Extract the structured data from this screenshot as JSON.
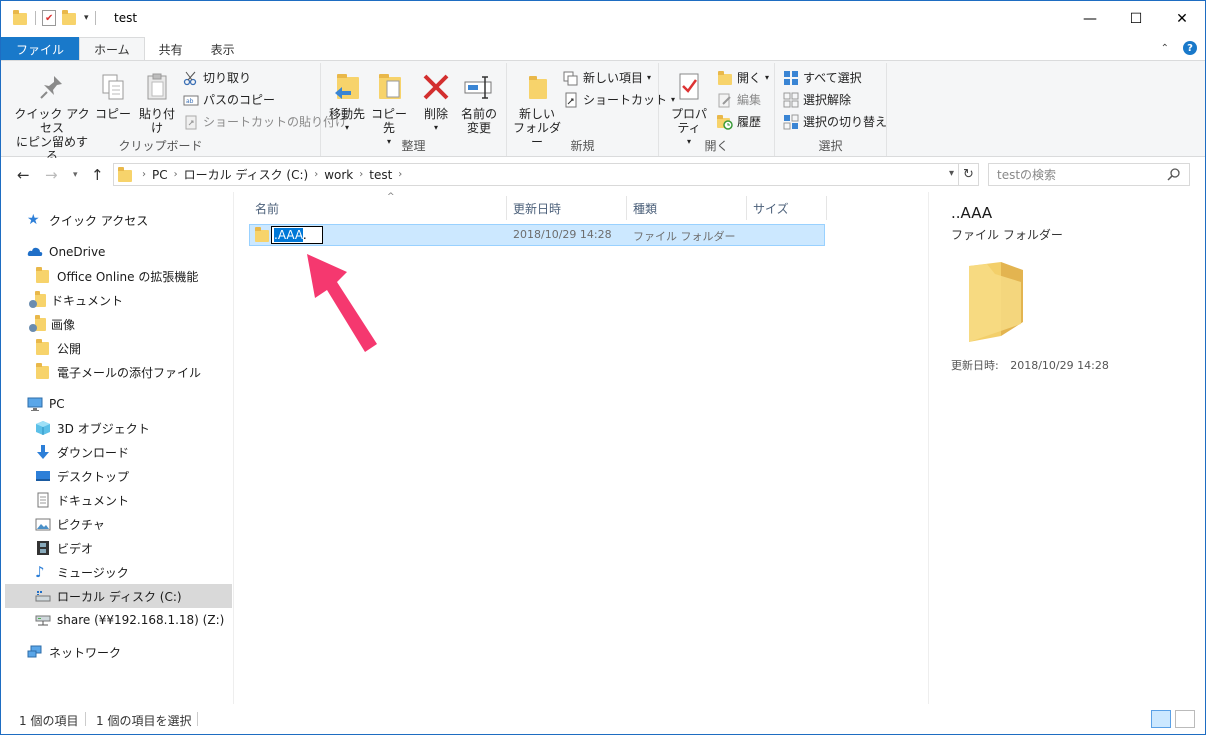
{
  "window": {
    "title": "test",
    "controls": {
      "minimize": "—",
      "maximize": "☐",
      "close": "✕"
    }
  },
  "tabs": {
    "file": "ファイル",
    "home": "ホーム",
    "share": "共有",
    "view": "表示"
  },
  "ribbon": {
    "clipboard": {
      "label": "クリップボード",
      "pin_quick_access_line1": "クイック アクセス",
      "pin_quick_access_line2": "にピン留めする",
      "copy": "コピー",
      "paste": "貼り付け",
      "cut": "切り取り",
      "copy_path": "パスのコピー",
      "paste_shortcut": "ショートカットの貼り付け"
    },
    "organize": {
      "label": "整理",
      "move_to": "移動先",
      "copy_to": "コピー先",
      "delete": "削除",
      "rename_line1": "名前の",
      "rename_line2": "変更"
    },
    "new": {
      "label": "新規",
      "new_folder_line1": "新しい",
      "new_folder_line2": "フォルダー",
      "new_item": "新しい項目",
      "easy_access": "ショートカット"
    },
    "open": {
      "label": "開く",
      "properties": "プロパティ",
      "open": "開く",
      "edit": "編集",
      "history": "履歴"
    },
    "select": {
      "label": "選択",
      "select_all": "すべて選択",
      "select_none": "選択解除",
      "invert_selection": "選択の切り替え"
    }
  },
  "address": {
    "crumbs": [
      "PC",
      "ローカル ディスク (C:)",
      "work",
      "test"
    ],
    "search_placeholder": "testの検索"
  },
  "navpane": {
    "quick_access": "クイック アクセス",
    "onedrive": "OneDrive",
    "onedrive_items": [
      "Office Online の拡張機能",
      "ドキュメント",
      "画像",
      "公開",
      "電子メールの添付ファイル"
    ],
    "pc": "PC",
    "pc_items": [
      "3D オブジェクト",
      "ダウンロード",
      "デスクトップ",
      "ドキュメント",
      "ピクチャ",
      "ビデオ",
      "ミュージック",
      "ローカル ディスク (C:)",
      "share (¥¥192.168.1.18) (Z:)"
    ],
    "network": "ネットワーク"
  },
  "columns": {
    "name": "名前",
    "modified": "更新日時",
    "type": "種類",
    "size": "サイズ"
  },
  "files": [
    {
      "name_prefix": ".AAA",
      "name_suffix": ".",
      "modified": "2018/10/29 14:28",
      "type": "ファイル フォルダー",
      "size": ""
    }
  ],
  "preview": {
    "title": "..AAA",
    "type": "ファイル フォルダー",
    "modified_label": "更新日時:",
    "modified_value": "2018/10/29 14:28"
  },
  "status": {
    "item_count": "1 個の項目",
    "selected_count": "1 個の項目を選択"
  },
  "colors": {
    "accent": "#1979ca",
    "selection": "#cce8ff",
    "annotation_arrow": "#f5386f"
  }
}
